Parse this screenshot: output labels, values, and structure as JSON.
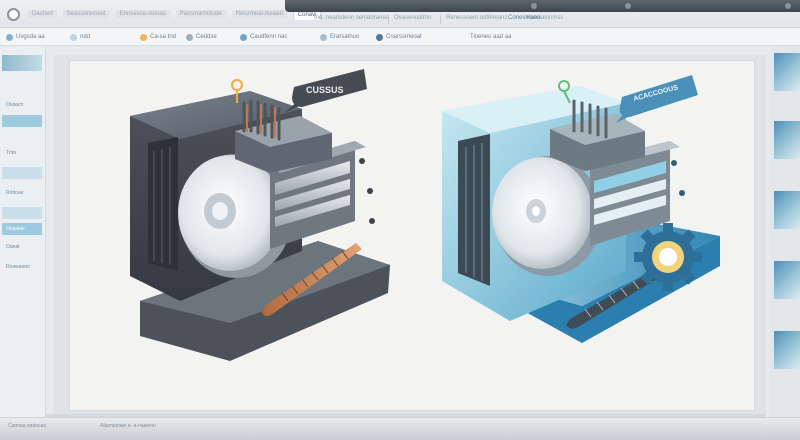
{
  "window": {
    "tabs": [
      "Dashed",
      "Seasonrement",
      "Ennsesce-stonas",
      "Passmarmitrate",
      "Renzmeal-tkeaed",
      "Conavi"
    ],
    "address_items": [
      "Ind. neamdenn senatoranea",
      "Ovasenoatmn",
      "Renessoent ootimeanz",
      "Voeniaionmss"
    ],
    "right_link": "Conesmaoo"
  },
  "toolbar": {
    "items": [
      "Uvgsda aa",
      "ndd",
      "Ca-sa tnd",
      "Ceddse",
      "Caudfenn nac",
      "Erarsatnuo",
      "Cnarssmeoat",
      "Tioeneu aad aa"
    ]
  },
  "sidebar": {
    "items": [
      "Ovaacn",
      "Tnta",
      "Rnttoae",
      "Ovaaeie",
      "Oanat",
      "Rnawaeno"
    ]
  },
  "canvas": {
    "left_tag": "CUSSUS",
    "right_tag": "ACACCOOUS"
  },
  "status": {
    "left": "Caonaa oadecaa",
    "middle": "Atlarnianiae o- a-naaeion"
  },
  "colors": {
    "accent": "#9ccbdf",
    "dark_chassis": "#5b6470",
    "light_chassis": "#a6d7e6",
    "gear": "#2d6f97"
  }
}
